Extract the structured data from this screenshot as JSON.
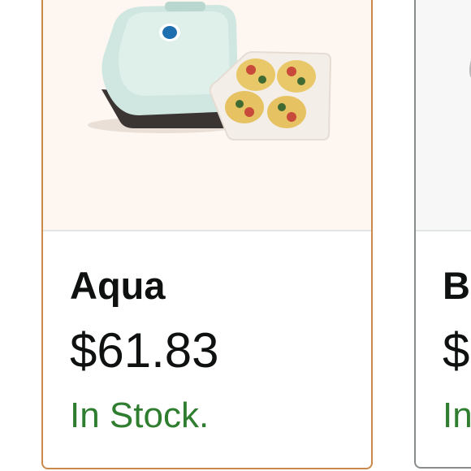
{
  "colors": {
    "selected_border": "#c8894a",
    "unselected_border": "#888c8c",
    "image_bg": "#fdf6f1",
    "text": "#0f1111",
    "stock": "#2f7d2f"
  },
  "swatches": [
    {
      "name": "Aqua",
      "price": "$61.83",
      "availability": "In Stock.",
      "selected": true,
      "image_icon": "waffle-maker-product-image"
    },
    {
      "name": "B",
      "price": "$",
      "availability": "In",
      "selected": false,
      "image_icon": "product-image"
    }
  ]
}
